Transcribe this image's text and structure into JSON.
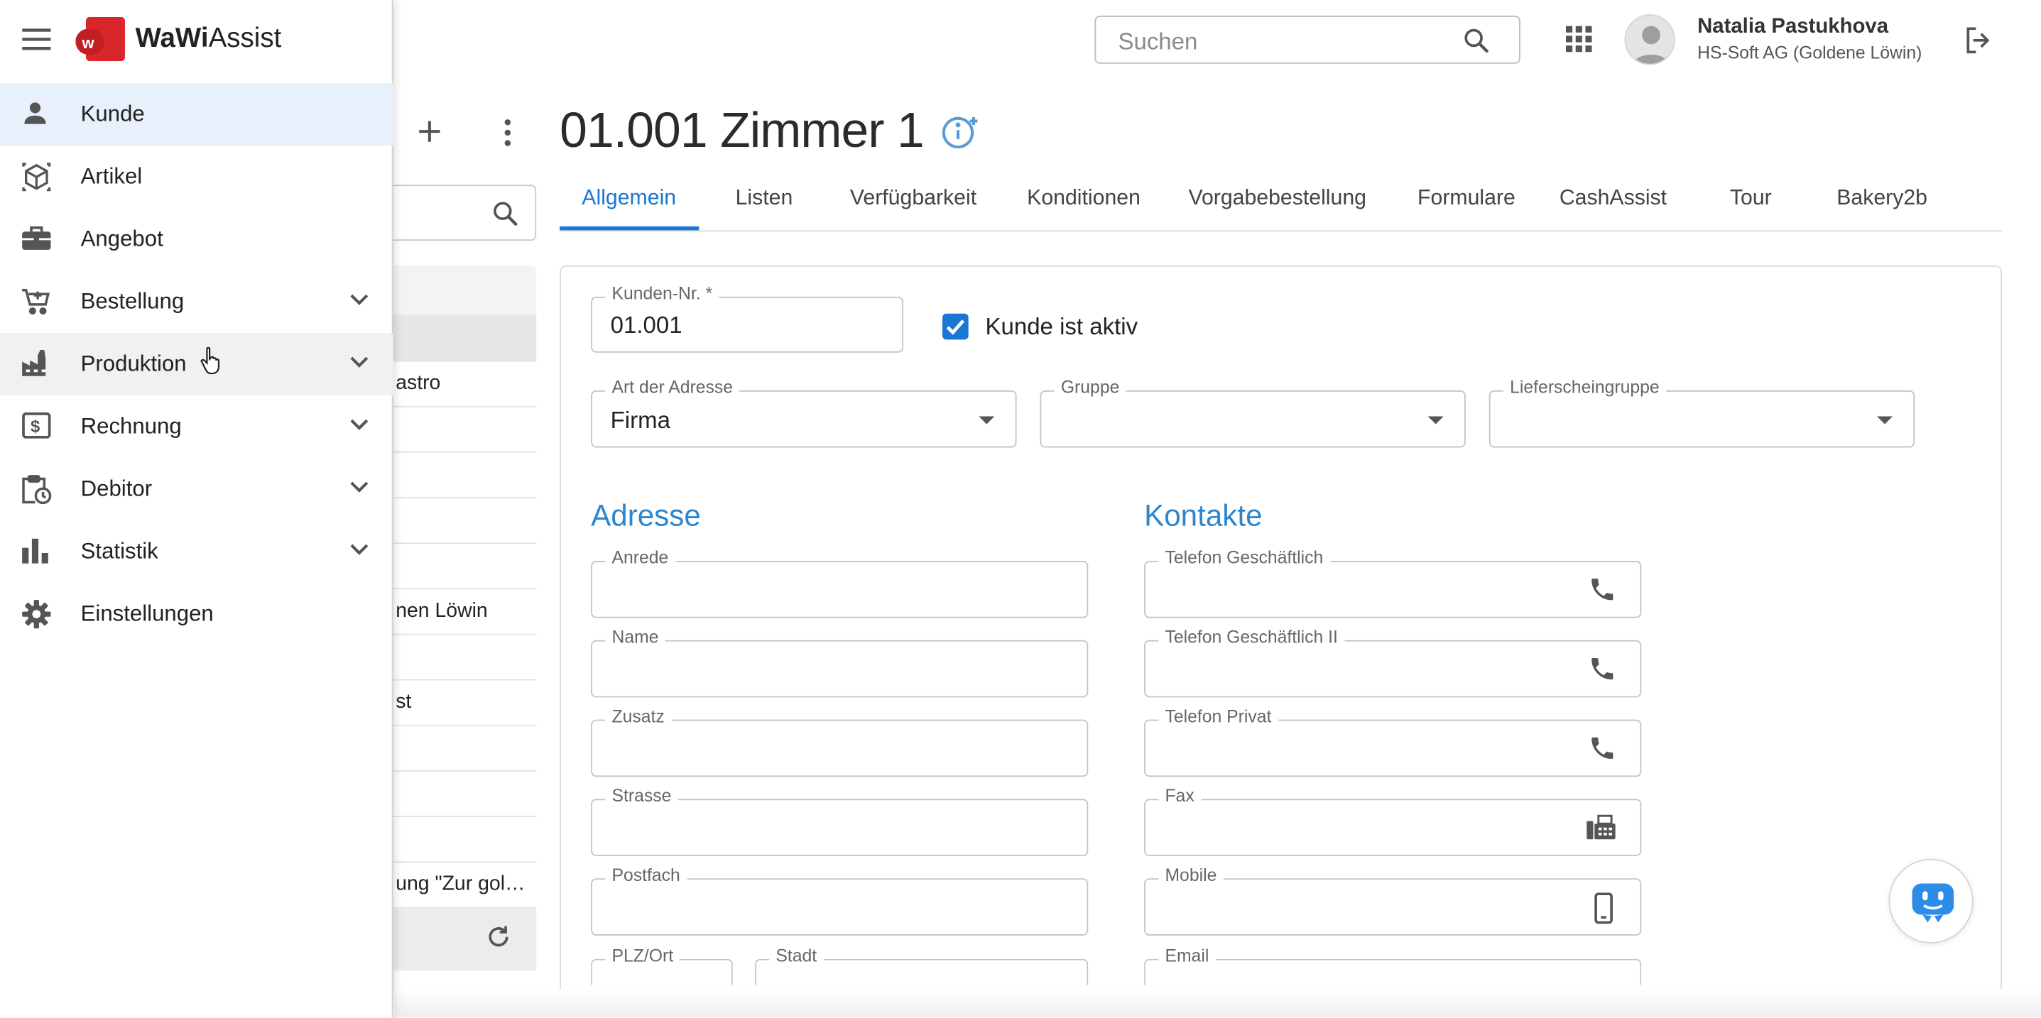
{
  "app": {
    "name_bold": "WaWi",
    "name_rest": "Assist",
    "logo_letter": "w"
  },
  "search": {
    "placeholder": "Suchen"
  },
  "user": {
    "name": "Natalia Pastukhova",
    "company": "HS-Soft AG (Goldene Löwin)"
  },
  "nav": {
    "items": [
      {
        "label": "Kunde",
        "icon": "person-icon",
        "state": "selected"
      },
      {
        "label": "Artikel",
        "icon": "box-icon"
      },
      {
        "label": "Angebot",
        "icon": "briefcase-icon"
      },
      {
        "label": "Bestellung",
        "icon": "cart-icon",
        "expandable": true
      },
      {
        "label": "Produktion",
        "icon": "factory-icon",
        "expandable": true,
        "state": "hover"
      },
      {
        "label": "Rechnung",
        "icon": "invoice-icon",
        "expandable": true
      },
      {
        "label": "Debitor",
        "icon": "clipboard-clock-icon",
        "expandable": true
      },
      {
        "label": "Statistik",
        "icon": "bar-chart-icon",
        "expandable": true
      },
      {
        "label": "Einstellungen",
        "icon": "gear-icon"
      }
    ]
  },
  "list": {
    "rows": [
      "astro",
      "",
      "",
      "",
      "",
      "nen Löwin",
      "",
      "st",
      "",
      "",
      "",
      "ung \"Zur gol…"
    ]
  },
  "record": {
    "title": "01.001 Zimmer 1"
  },
  "tabs": [
    "Allgemein",
    "Listen",
    "Verfügbarkeit",
    "Konditionen",
    "Vorgabebestellung",
    "Formulare",
    "CashAssist",
    "Tour",
    "Bakery2b"
  ],
  "form": {
    "kunden_nr_label": "Kunden-Nr. *",
    "kunden_nr_value": "01.001",
    "aktiv_label": "Kunde ist aktiv",
    "aktiv_checked": true,
    "art_label": "Art der Adresse",
    "art_value": "Firma",
    "gruppe_label": "Gruppe",
    "lieferschein_label": "Lieferscheingruppe",
    "adresse_title": "Adresse",
    "kontakte_title": "Kontakte",
    "adresse_fields": [
      "Anrede",
      "Name",
      "Zusatz",
      "Strasse",
      "Postfach"
    ],
    "plz_label": "PLZ/Ort",
    "stadt_label": "Stadt",
    "kontakt_fields": [
      {
        "label": "Telefon Geschäftlich",
        "icon": "phone-icon"
      },
      {
        "label": "Telefon Geschäftlich II",
        "icon": "phone-icon"
      },
      {
        "label": "Telefon Privat",
        "icon": "phone-icon"
      },
      {
        "label": "Fax",
        "icon": "fax-icon"
      },
      {
        "label": "Mobile",
        "icon": "mobile-icon"
      }
    ],
    "email_label": "Email"
  },
  "colors": {
    "accent": "#1976d2",
    "section": "#2b86cf",
    "logo": "#d9262b",
    "selected_nav": "#e8f0fb"
  }
}
